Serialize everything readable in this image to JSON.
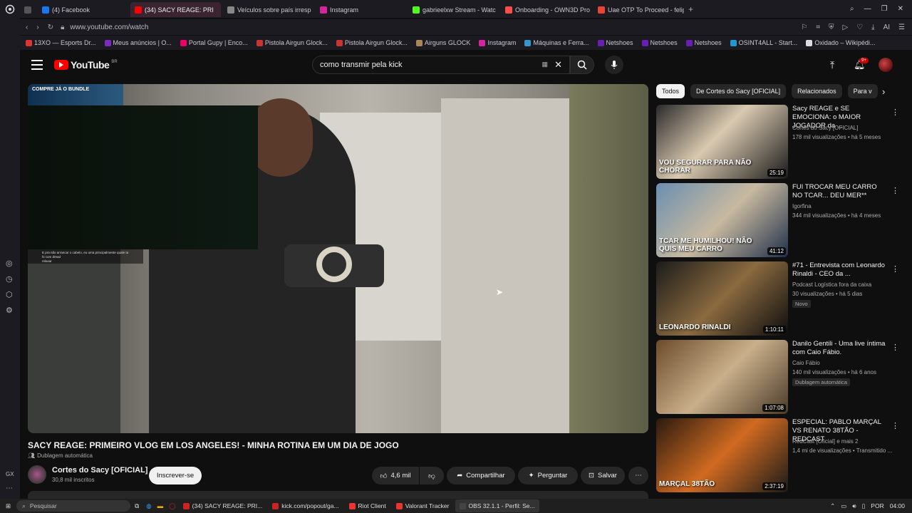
{
  "browser": {
    "tabs": [
      {
        "label": "",
        "color": "#555"
      },
      {
        "label": "(4) Facebook",
        "color": "#1877f2"
      },
      {
        "label": "(34) SACY REAGE: PRI",
        "color": "#ff0000",
        "active": true
      },
      {
        "label": "Veículos sobre país irresp",
        "color": "#888"
      },
      {
        "label": "Instagram",
        "color": "#d6249f"
      },
      {
        "label": "gabrieelxw Stream - Watc",
        "color": "#53fc18"
      },
      {
        "label": "Onboarding - OWN3D Pro",
        "color": "#ff4b4b"
      },
      {
        "label": "Uae OTP To Proceed - felip",
        "color": "#ea4335"
      }
    ],
    "new_tab": "+",
    "url": "www.youtube.com/watch",
    "bookmarks": [
      {
        "label": "13XO — Esports Dr...",
        "color": "#d33"
      },
      {
        "label": "Meus anúncios | O...",
        "color": "#7b2cbf"
      },
      {
        "label": "Portal Gupy | Enco...",
        "color": "#e06"
      },
      {
        "label": "Pistola Airgun Glock...",
        "color": "#c33"
      },
      {
        "label": "Pistola Airgun Glock...",
        "color": "#c33"
      },
      {
        "label": "Airguns GLOCK",
        "color": "#a85"
      },
      {
        "label": "Instagram",
        "color": "#d6249f"
      },
      {
        "label": "Máquinas e Ferra...",
        "color": "#39c"
      },
      {
        "label": "Netshoes",
        "color": "#6b1fb1"
      },
      {
        "label": "Netshoes",
        "color": "#6b1fb1"
      },
      {
        "label": "Netshoes",
        "color": "#6b1fb1"
      },
      {
        "label": "OSINT4ALL - Start...",
        "color": "#29c"
      },
      {
        "label": "Oxidado – Wikipédi...",
        "color": "#ddd"
      }
    ]
  },
  "youtube": {
    "logo": "YouTube",
    "logo_region": "BR",
    "search_query": "como transmir pela kick",
    "notification_count": "9+",
    "video": {
      "title": "SACY REAGE: PRIMEIRO VLOG EM LOS ANGELES! - MINHA ROTINA EM UM DIA DE JOGO",
      "dub_label": "Dublagem automática",
      "overlay_top_text": "COMPRE JÁ O BUNDLE",
      "chat_line": "E pra não arrancar o cabelo, eu uma principalmente quale ta hi com dread",
      "chat_reply": "relaxar"
    },
    "channel": {
      "name": "Cortes do Sacy [OFICIAL]",
      "subs": "30,8 mil inscritos",
      "subscribe_label": "Inscrever-se"
    },
    "actions": {
      "likes": "4,6 mil",
      "share": "Compartilhar",
      "ask": "Perguntar",
      "save": "Salvar"
    },
    "chips": [
      "Todos",
      "De Cortes do Sacy [OFICIAL]",
      "Relacionados",
      "Para v"
    ],
    "recommendations": [
      {
        "title": "Sacy REAGE e SE EMOCIONA: o MAIOR JOGADOR da ...",
        "channel": "Cortes do Sacy [OFICIAL]",
        "meta": "178 mil visualizações • há 5 meses",
        "duration": "25:19",
        "thumb_text": "VOU SEGURAR PARA NÃO CHORAR",
        "badge": ""
      },
      {
        "title": "FUI TROCAR MEU CARRO NO TCAR... DEU MER**",
        "channel": "Igorfina",
        "meta": "344 mil visualizações • há 4 meses",
        "duration": "41:12",
        "thumb_text": "TCAR ME HUMILHOU! NÃO QUIS MEU CARRO",
        "badge": ""
      },
      {
        "title": "#71 - Entrevista com Leonardo Rinaldi - CEO da ...",
        "channel": "Podcast Logística fora da caixa",
        "meta": "30 visualizações • há 5 dias",
        "duration": "1:10:11",
        "thumb_text": "LEONARDO RINALDI",
        "badge": "Novo"
      },
      {
        "title": "Danilo Gentili - Uma live íntima com Caio Fábio.",
        "channel": "Caio Fábio",
        "meta": "140 mil visualizações • há 6 anos",
        "duration": "1:07:08",
        "thumb_text": "",
        "badge": "Dublagem automática"
      },
      {
        "title": "ESPECIAL: PABLO MARÇAL VS RENATO 38TÃO - REDCAST",
        "channel": "RedCast [Oficial] e mais 2",
        "meta": "1,4 mi de visualizações • Transmitido ...",
        "duration": "2:37:19",
        "thumb_text": "MARÇAL   38TÃO",
        "badge": ""
      }
    ]
  },
  "taskbar": {
    "search_placeholder": "Pesquisar",
    "items": [
      {
        "label": "(34) SACY REAGE: PRI...",
        "color": "#c22"
      },
      {
        "label": "kick.com/popout/ga...",
        "color": "#c22"
      },
      {
        "label": "Riot Client",
        "color": "#e33"
      },
      {
        "label": "Valorant Tracker",
        "color": "#e33"
      },
      {
        "label": "OBS 32.1.1 - Perfil: Se...",
        "color": "#444"
      }
    ],
    "lang": "POR",
    "time": "04:00"
  }
}
